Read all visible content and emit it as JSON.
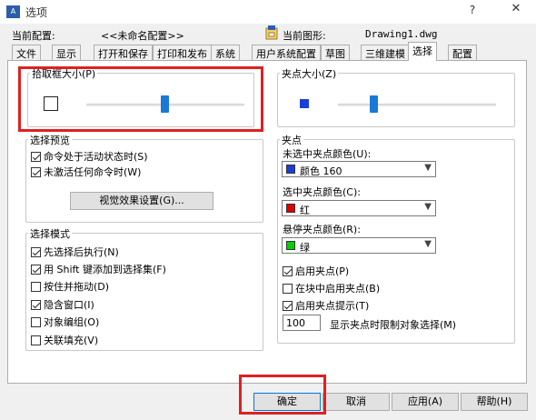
{
  "window": {
    "title": "选项",
    "app_icon": "A",
    "help_label": "?",
    "close_label": "✕"
  },
  "header": {
    "config_label": "当前配置:",
    "config_value": "<<未命名配置>>",
    "drawing_label": "当前图形:",
    "drawing_value": "Drawing1.dwg"
  },
  "tabs": [
    {
      "label": "文件"
    },
    {
      "label": "显示"
    },
    {
      "label": "打开和保存"
    },
    {
      "label": "打印和发布"
    },
    {
      "label": "系统"
    },
    {
      "label": "用户系统配置"
    },
    {
      "label": "草图"
    },
    {
      "label": "三维建模"
    },
    {
      "label": "选择"
    },
    {
      "label": "配置"
    }
  ],
  "active_tab": "选择",
  "pickbox": {
    "title": "拾取框大小(P)",
    "slider_value": 0.5
  },
  "grip_size": {
    "title": "夹点大小(Z)",
    "slider_value": 0.5
  },
  "preview": {
    "title": "选择预览",
    "items": [
      {
        "label": "命令处于活动状态时(S)",
        "checked": true
      },
      {
        "label": "未激活任何命令时(W)",
        "checked": true
      }
    ],
    "visual_button": "视觉效果设置(G)..."
  },
  "mode": {
    "title": "选择模式",
    "items": [
      {
        "label": "先选择后执行(N)",
        "checked": true
      },
      {
        "label": "用 Shift 键添加到选择集(F)",
        "checked": true
      },
      {
        "label": "按住并拖动(D)",
        "checked": false
      },
      {
        "label": "隐含窗口(I)",
        "checked": true
      },
      {
        "label": "对象编组(O)",
        "checked": false
      },
      {
        "label": "关联填充(V)",
        "checked": false
      }
    ]
  },
  "grips": {
    "title": "夹点",
    "unselected_label": "未选中夹点颜色(U):",
    "unselected_value": "颜色 160",
    "unselected_color": "#1a3fd6",
    "selected_label": "选中夹点颜色(C):",
    "selected_value": "红",
    "selected_color": "#e00000",
    "hover_label": "悬停夹点颜色(R):",
    "hover_value": "绿",
    "hover_color": "#00d000",
    "checks": [
      {
        "label": "启用夹点(P)",
        "checked": true
      },
      {
        "label": "在块中启用夹点(B)",
        "checked": false
      },
      {
        "label": "启用夹点提示(T)",
        "checked": true
      }
    ],
    "limit_value": "100",
    "limit_label": "显示夹点时限制对象选择(M)"
  },
  "buttons": {
    "ok": "确定",
    "cancel": "取消",
    "apply": "应用(A)",
    "help": "帮助(H)"
  },
  "colors": {
    "accent": "#1a78d7",
    "highlight_box": "#e02020"
  }
}
